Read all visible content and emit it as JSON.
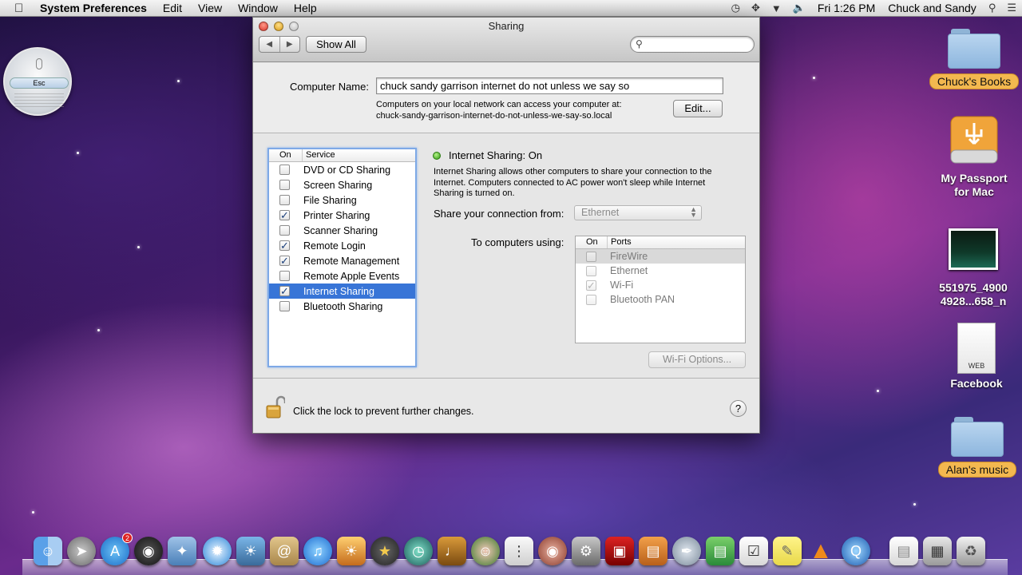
{
  "menubar": {
    "app_name": "System Preferences",
    "menus": [
      "Edit",
      "View",
      "Window",
      "Help"
    ],
    "clock": "Fri 1:26 PM",
    "user": "Chuck and Sandy"
  },
  "esc_widget": {
    "label": "Esc"
  },
  "window": {
    "title": "Sharing",
    "show_all_label": "Show All",
    "search_placeholder": ""
  },
  "computer_name": {
    "label": "Computer Name:",
    "value": "chuck sandy garrison  internet do not unless we say so",
    "desc_line1": "Computers on your local network can access your computer at:",
    "desc_line2": "chuck-sandy-garrison-internet-do-not-unless-we-say-so.local",
    "edit_label": "Edit..."
  },
  "services": {
    "header_on": "On",
    "header_service": "Service",
    "items": [
      {
        "name": "DVD or CD Sharing",
        "checked": false
      },
      {
        "name": "Screen Sharing",
        "checked": false
      },
      {
        "name": "File Sharing",
        "checked": false
      },
      {
        "name": "Printer Sharing",
        "checked": true
      },
      {
        "name": "Scanner Sharing",
        "checked": false
      },
      {
        "name": "Remote Login",
        "checked": true
      },
      {
        "name": "Remote Management",
        "checked": true
      },
      {
        "name": "Remote Apple Events",
        "checked": false
      },
      {
        "name": "Internet Sharing",
        "checked": true,
        "selected": true
      },
      {
        "name": "Bluetooth Sharing",
        "checked": false
      }
    ]
  },
  "detail": {
    "status": "Internet Sharing: On",
    "description": "Internet Sharing allows other computers to share your connection to the Internet. Computers connected to AC power won't sleep while Internet Sharing is turned on.",
    "share_from_label": "Share your connection from:",
    "share_from_value": "Ethernet",
    "to_computers_label": "To computers using:",
    "ports_header_on": "On",
    "ports_header_ports": "Ports",
    "ports": [
      {
        "name": "FireWire",
        "checked": false
      },
      {
        "name": "Ethernet",
        "checked": false
      },
      {
        "name": "Wi-Fi",
        "checked": true
      },
      {
        "name": "Bluetooth PAN",
        "checked": false
      }
    ],
    "wifi_options_label": "Wi-Fi Options..."
  },
  "footer": {
    "lock_text": "Click the lock to prevent further changes.",
    "help_label": "?"
  },
  "desktop": {
    "chucks_books": "Chuck's Books",
    "passport_line1": "My Passport",
    "passport_line2": "for Mac",
    "image_line1": "551975_4900",
    "image_line2": "4928...658_n",
    "facebook_badge": "WEB",
    "facebook": "Facebook",
    "alans_music": "Alan's music"
  },
  "dock": {
    "app_store_badge": "2"
  },
  "colors": {
    "selection": "#3875d7",
    "status_green": "#2f9a12",
    "folder_label": "#f3b84f"
  }
}
